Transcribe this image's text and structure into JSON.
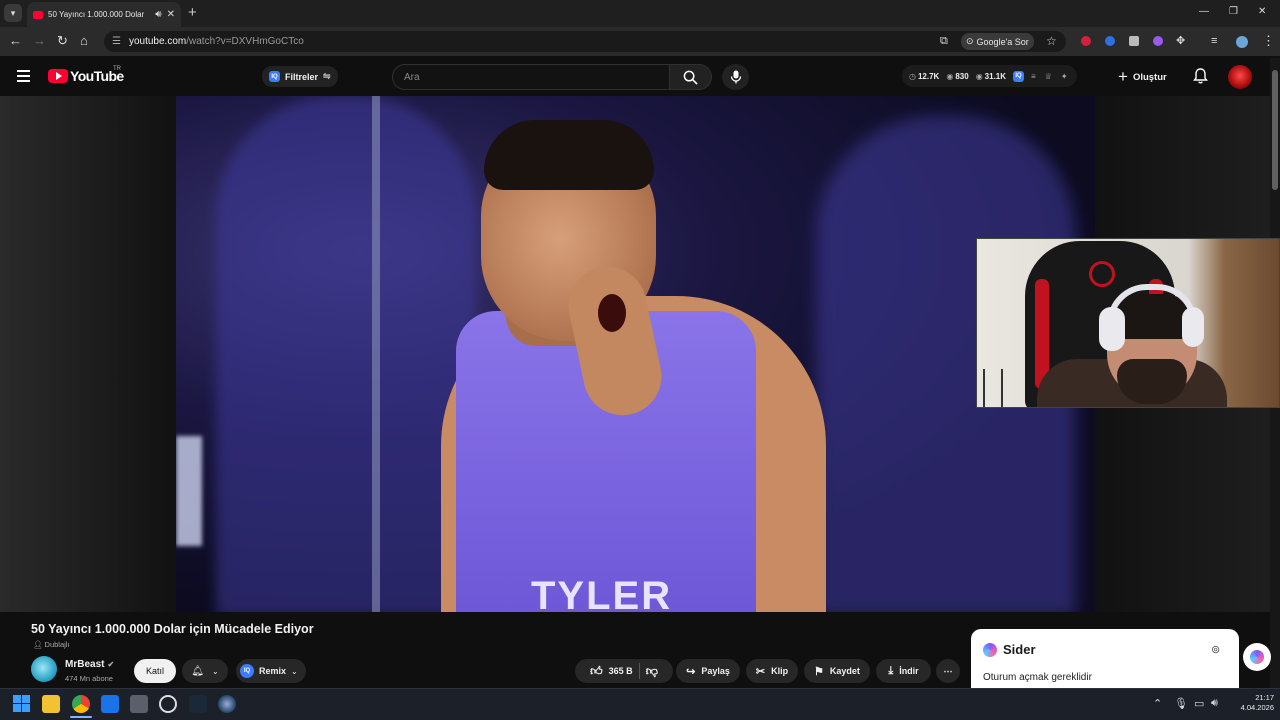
{
  "browser": {
    "tab_title": "50 Yayıncı 1.000.000 Dolar",
    "url_host": "youtube.com",
    "url_path": "/watch?v=DXVHmGoCTco",
    "google_ask_label": "Google'a Sor"
  },
  "masthead": {
    "logo_text": "YouTube",
    "country_code": "TR",
    "filters_label": "Filtreler",
    "iq_badge": "IQ",
    "search_placeholder": "Ara",
    "stats": {
      "views": "12.7K",
      "likes": "830",
      "watching": "31.1K"
    },
    "create_label": "Oluştur"
  },
  "video": {
    "title": "50 Yayıncı 1.000.000 Dolar için Mücadele Ediyor",
    "dubbed_label": "Dublajlı",
    "frame_text": "TYLER"
  },
  "channel": {
    "name": "MrBeast",
    "subscribers": "474 Mn abone",
    "join_label": "Katıl",
    "remix_label": "Remix"
  },
  "actions": {
    "like_count": "365 B",
    "share_label": "Paylaş",
    "clip_label": "Klip",
    "save_label": "Kaydet",
    "download_label": "İndir"
  },
  "sider": {
    "title": "Sider",
    "message": "Oturum açmak gereklidir"
  },
  "taskbar": {
    "time": "21:17",
    "date": "4.04.2026"
  },
  "colors": {
    "youtube_red": "#ff0033",
    "background": "#0f0f0f",
    "pill": "#272727",
    "iq_blue": "#3d7bff"
  }
}
